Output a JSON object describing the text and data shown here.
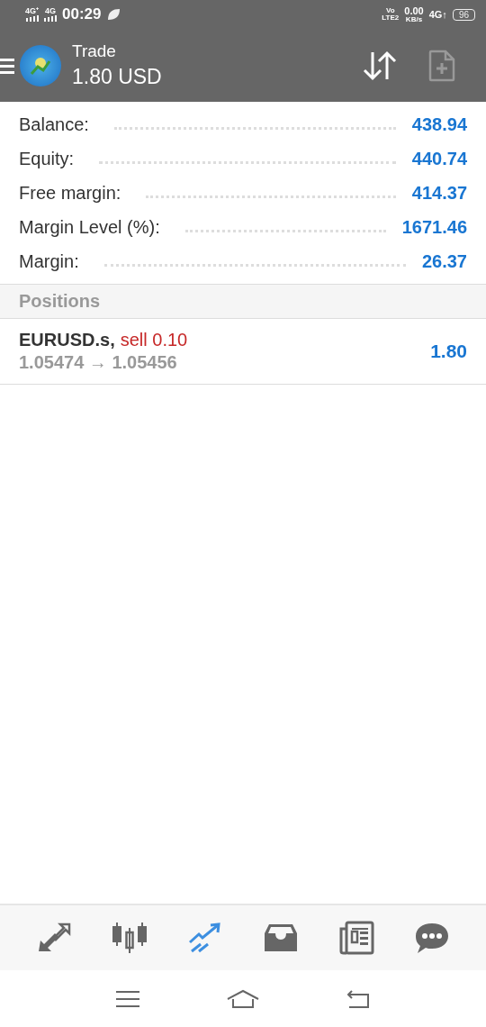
{
  "status_bar": {
    "sim1": "4G⁺",
    "sim2": "4G",
    "time": "00:29",
    "volte": "Vo\nLTE2",
    "speed": "0.00",
    "speed_unit": "KB/s",
    "network": "4G↑",
    "battery": "96"
  },
  "app_bar": {
    "title": "Trade",
    "subtitle": "1.80 USD"
  },
  "summary": [
    {
      "label": "Balance:",
      "value": "438.94"
    },
    {
      "label": "Equity:",
      "value": "440.74"
    },
    {
      "label": "Free margin:",
      "value": "414.37"
    },
    {
      "label": "Margin Level (%):",
      "value": "1671.46"
    },
    {
      "label": "Margin:",
      "value": "26.37"
    }
  ],
  "positions": {
    "title": "Positions",
    "items": [
      {
        "symbol": "EURUSD.s,",
        "side": "sell 0.10",
        "prices": "1.05474 → 1.05456",
        "profit": "1.80"
      }
    ]
  },
  "bottom_tabs": [
    {
      "kind": "quotes",
      "selected": false
    },
    {
      "kind": "chart",
      "selected": false
    },
    {
      "kind": "trade",
      "selected": true
    },
    {
      "kind": "history",
      "selected": false
    },
    {
      "kind": "news",
      "selected": false
    },
    {
      "kind": "messages",
      "selected": false
    }
  ],
  "system_nav": [
    {
      "kind": "menu"
    },
    {
      "kind": "home"
    },
    {
      "kind": "back"
    }
  ]
}
